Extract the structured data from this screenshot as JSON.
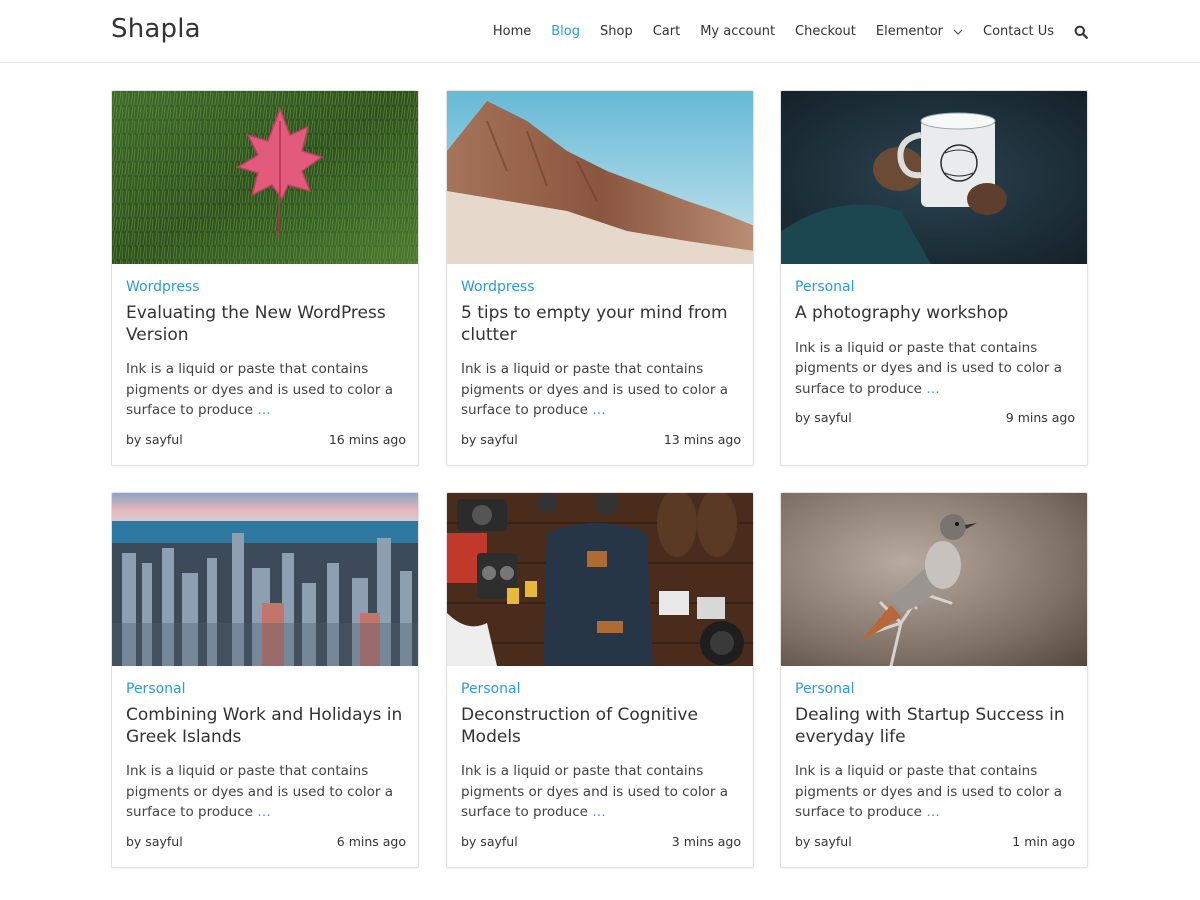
{
  "site": {
    "name": "Shapla"
  },
  "nav": {
    "items": [
      "Home",
      "Blog",
      "Shop",
      "Cart",
      "My account",
      "Checkout",
      "Elementor",
      "Contact Us"
    ],
    "active": "Blog",
    "search_icon": "search-icon",
    "dropdown_icon": "chevron-down-icon"
  },
  "colors": {
    "accent": "#2d9ad8",
    "text": "#323232",
    "border": "#e2e2e2"
  },
  "posts": [
    {
      "category": "Wordpress",
      "title": "Evaluating the New WordPress Version",
      "excerpt": "Ink is a liquid or paste that contains pigments or dyes and is used to color a surface to produce",
      "more": "…",
      "author": "by sayful",
      "time": "16 mins ago",
      "image": "red-maple-leaf-on-grass"
    },
    {
      "category": "Wordpress",
      "title": "5 tips to empty your mind from clutter",
      "excerpt": "Ink is a liquid or paste that contains pigments or dyes and is used to color a surface to produce",
      "more": "…",
      "author": "by sayful",
      "time": "13 mins ago",
      "image": "desert-mountain-ridge"
    },
    {
      "category": "Personal",
      "title": "A photography workshop",
      "excerpt": "Ink is a liquid or paste that contains pigments or dyes and is used to color a surface to produce",
      "more": "…",
      "author": "by sayful",
      "time": "9 mins ago",
      "image": "hands-holding-enamel-mug"
    },
    {
      "category": "Personal",
      "title": "Combining Work and Holidays in Greek Islands",
      "excerpt": "Ink is a liquid or paste that contains pigments or dyes and is used to color a surface to produce",
      "more": "…",
      "author": "by sayful",
      "time": "6 mins ago",
      "image": "city-skyline-by-lake"
    },
    {
      "category": "Personal",
      "title": "Deconstruction of Cognitive Models",
      "excerpt": "Ink is a liquid or paste that contains pigments or dyes and is used to color a surface to produce",
      "more": "…",
      "author": "by sayful",
      "time": "3 mins ago",
      "image": "travel-gear-flatlay"
    },
    {
      "category": "Personal",
      "title": "Dealing with Startup Success in everyday life",
      "excerpt": "Ink is a liquid or paste that contains pigments or dyes and is used to color a surface to produce",
      "more": "…",
      "author": "by sayful",
      "time": "1 min ago",
      "image": "bird-on-branch"
    }
  ]
}
